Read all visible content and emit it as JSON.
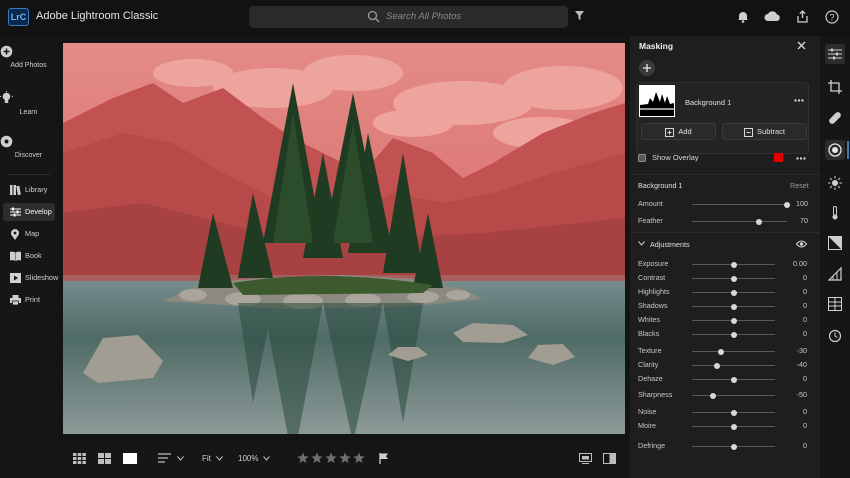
{
  "app": {
    "logo": "LrC",
    "title": "Adobe Lightroom Classic"
  },
  "search": {
    "placeholder": "Search All Photos"
  },
  "left_rail": {
    "actions": [
      {
        "label": "Add Photos",
        "icon": "plus-circle-icon"
      },
      {
        "label": "Learn",
        "icon": "lightbulb-icon"
      },
      {
        "label": "Discover",
        "icon": "compass-icon"
      }
    ],
    "modules": [
      {
        "label": "Library",
        "icon": "library-icon"
      },
      {
        "label": "Develop",
        "icon": "develop-icon",
        "selected": true
      },
      {
        "label": "Map",
        "icon": "map-pin-icon"
      },
      {
        "label": "Book",
        "icon": "book-icon"
      },
      {
        "label": "Slideshow",
        "icon": "slideshow-icon"
      },
      {
        "label": "Print",
        "icon": "print-icon"
      }
    ]
  },
  "toolbar": {
    "zoom_mode": "Fit",
    "zoom_level": "100%",
    "rating_stars": 5
  },
  "masking": {
    "title": "Masking",
    "mask_name": "Background 1",
    "add_label": "Add",
    "subtract_label": "Subtract",
    "show_overlay_label": "Show Overlay",
    "overlay_color": "#e00000",
    "section_title": "Background 1",
    "reset_label": "Reset",
    "amount": {
      "label": "Amount",
      "value": "100",
      "level": 1.0
    },
    "feather": {
      "label": "Feather",
      "value": "70",
      "level": 0.7
    },
    "adjustments_title": "Adjustments",
    "adjustments": [
      {
        "label": "Exposure",
        "value": "0.00",
        "level": 0.5
      },
      {
        "label": "Contrast",
        "value": "0",
        "level": 0.5
      },
      {
        "label": "Highlights",
        "value": "0",
        "level": 0.5
      },
      {
        "label": "Shadows",
        "value": "0",
        "level": 0.5
      },
      {
        "label": "Whites",
        "value": "0",
        "level": 0.5
      },
      {
        "label": "Blacks",
        "value": "0",
        "level": 0.5
      },
      {
        "label": "Texture",
        "value": "-30",
        "level": 0.35
      },
      {
        "label": "Clarity",
        "value": "-40",
        "level": 0.3
      },
      {
        "label": "Dehaze",
        "value": "0",
        "level": 0.5
      },
      {
        "label": "Sharpness",
        "value": "-50",
        "level": 0.25
      },
      {
        "label": "Noise",
        "value": "0",
        "level": 0.5
      },
      {
        "label": "Moire",
        "value": "0",
        "level": 0.5
      },
      {
        "label": "Defringe",
        "value": "0",
        "level": 0.5
      }
    ]
  },
  "colors": {
    "accent": "#3a7bbf",
    "overlay_tint": "#e86a6a",
    "panel_bg": "#1e1e1e"
  }
}
